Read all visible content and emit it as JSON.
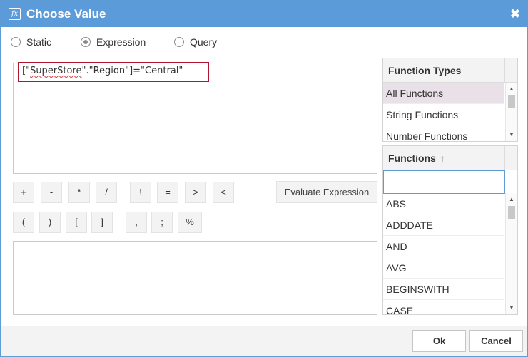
{
  "window": {
    "title": "Choose Value",
    "title_icon": "fx-function-icon",
    "close_icon": "close-icon",
    "close_glyph": "✖"
  },
  "value_type": {
    "options": [
      {
        "label": "Static",
        "selected": false
      },
      {
        "label": "Expression",
        "selected": true
      },
      {
        "label": "Query",
        "selected": false
      }
    ]
  },
  "expression": {
    "prefix": "[\"",
    "misspelled": "SuperStore",
    "suffix": "\".\"Region\"]=\"Central\""
  },
  "operators": {
    "row1": [
      "+",
      "-",
      "*",
      "/",
      "!",
      "=",
      ">",
      "<"
    ],
    "row2": [
      "(",
      ")",
      "[",
      "]",
      ",",
      ";",
      "%"
    ]
  },
  "evaluate_label": "Evaluate Expression",
  "function_types": {
    "header": "Function Types",
    "items": [
      "All Functions",
      "String Functions",
      "Number Functions"
    ],
    "selected_index": 0
  },
  "functions": {
    "header": "Functions",
    "sort_glyph": "↑",
    "search_value": "",
    "items": [
      "ABS",
      "ADDDATE",
      "AND",
      "AVG",
      "BEGINSWITH",
      "CASE"
    ]
  },
  "footer": {
    "ok_label": "Ok",
    "cancel_label": "Cancel"
  },
  "colors": {
    "titlebar": "#5b9bd9",
    "highlight": "#b0172e",
    "selected_row": "#eae0e8"
  }
}
